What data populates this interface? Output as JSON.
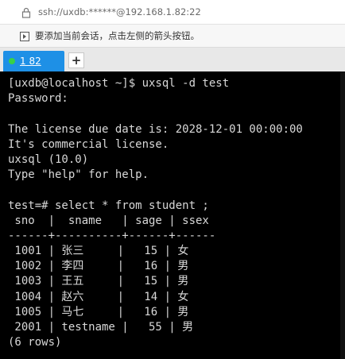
{
  "address_bar": {
    "url": "ssh://uxdb:******@192.168.1.82:22"
  },
  "hint_bar": {
    "text": "要添加当前会话，点击左侧的箭头按钮。"
  },
  "tabs": [
    {
      "label": "1 82",
      "active": true,
      "status_color": "#38d148"
    }
  ],
  "new_tab_symbol": "+",
  "terminal": {
    "lines": [
      "[uxdb@localhost ~]$ uxsql -d test",
      "Password:",
      "",
      "The license due date is: 2028-12-01 00:00:00",
      "It's commercial license.",
      "uxsql (10.0)",
      "Type \"help\" for help.",
      "",
      "test=# select * from student ;",
      " sno  |  sname   | sage | ssex",
      "------+----------+------+------",
      " 1001 | 张三     |   15 | 女",
      " 1002 | 李四     |   16 | 男",
      " 1003 | 王五     |   15 | 男",
      " 1004 | 赵六     |   14 | 女",
      " 1005 | 马七     |   16 | 男",
      " 2001 | testname |   55 | 男",
      "(6 rows)"
    ]
  },
  "colors": {
    "terminal_bg": "#000000",
    "terminal_fg": "#d8d8d8",
    "tab_active_bg": "#1e90e6"
  }
}
